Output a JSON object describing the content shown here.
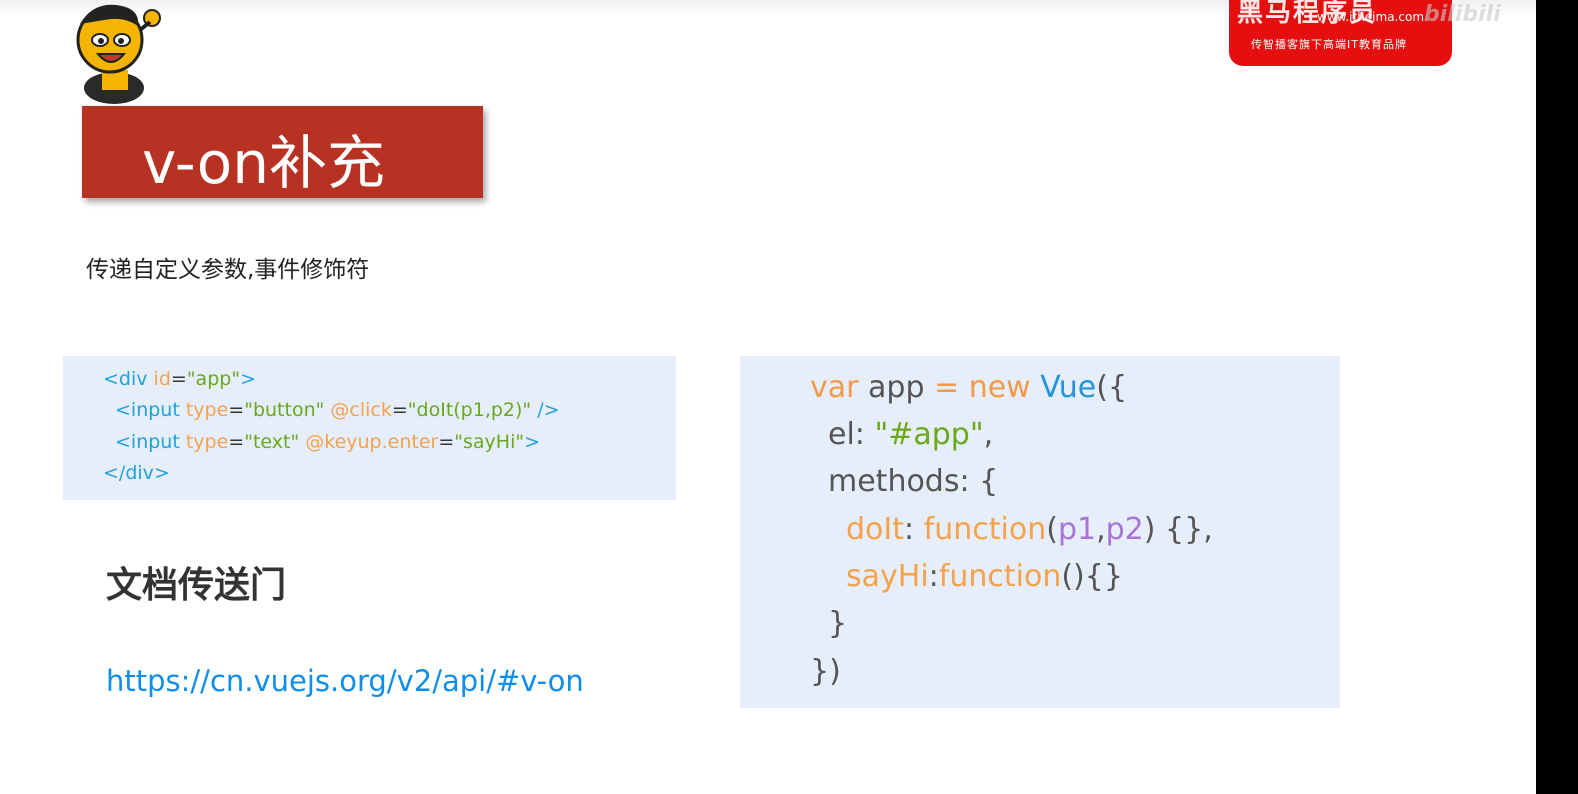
{
  "logo": {
    "brand": "黑马程序员",
    "url": "www.itheima.com",
    "tagline": "传智播客旗下高端IT教育品牌"
  },
  "watermark": "bilibili",
  "slide": {
    "title": "v-on补充",
    "subtitle": "传递自定义参数,事件修饰符",
    "docs_title": "文档传送门",
    "docs_link": "https://cn.vuejs.org/v2/api/#v-on"
  },
  "html_code": {
    "line1": {
      "open": "<div ",
      "attr": "id",
      "eq": "=",
      "val": "\"app\"",
      "close": ">"
    },
    "line2": {
      "open": "<input ",
      "attr1": "type",
      "eq1": "=",
      "val1": "\"button\"",
      "sp": " ",
      "attr2": "@click",
      "eq2": "=",
      "val2": "\"doIt(p1,p2)\"",
      "close": " />"
    },
    "line3": {
      "open": "<input ",
      "attr1": "type",
      "eq1": "=",
      "val1": "\"text\"",
      "sp": " ",
      "attr2": "@keyup.enter",
      "eq2": "=",
      "val2": "\"sayHi\"",
      "close": ">"
    },
    "line4": {
      "close": "</div>"
    }
  },
  "js_code": {
    "line1": {
      "kw1": "var",
      "name": " app ",
      "op": "=",
      "kw2": " new ",
      "cls": "Vue",
      "punc": "({"
    },
    "line2": {
      "key": "el: ",
      "val": "\"#app\"",
      "punc": ","
    },
    "line3": {
      "key": "methods: {"
    },
    "line4": {
      "fn": "doIt",
      "colon": ": ",
      "kw": "function",
      "p_open": "(",
      "p1": "p1",
      "comma": ",",
      "p2": "p2",
      "rest": ") {},"
    },
    "line5": {
      "fn": "sayHi",
      "colon": ":",
      "kw": "function",
      "rest": "(){}"
    },
    "line6": {
      "punc": "}"
    },
    "line7": {
      "punc": "})"
    }
  }
}
